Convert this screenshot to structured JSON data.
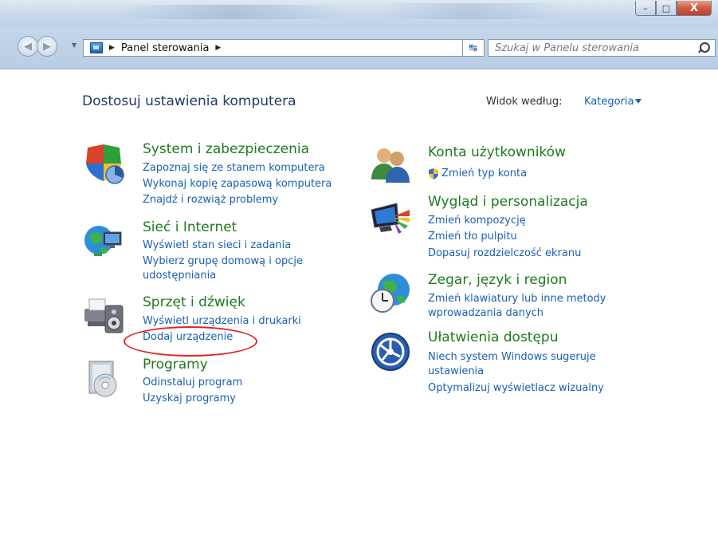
{
  "window": {
    "controls": {
      "minimize": "–",
      "maximize": "□",
      "close": "X"
    }
  },
  "nav": {
    "back_icon": "back-arrow-icon",
    "forward_icon": "forward-arrow-icon",
    "breadcrumb": [
      "Panel sterowania"
    ],
    "search_placeholder": "Szukaj w Panelu sterowania"
  },
  "header": {
    "title": "Dostosuj ustawienia komputera",
    "view_by_label": "Widok według:",
    "view_by_value": "Kategoria"
  },
  "categories_left": [
    {
      "title": "System i zabezpieczenia",
      "icon": "shield-pie-icon",
      "links": [
        "Zapoznaj się ze stanem komputera",
        "Wykonaj kopię zapasową komputera",
        "Znajdź i rozwiąż problemy"
      ]
    },
    {
      "title": "Sieć i Internet",
      "icon": "network-globe-icon",
      "links": [
        "Wyświetl stan sieci i zadania",
        "Wybierz grupę domową i opcje",
        "udostępniania"
      ]
    },
    {
      "title": "Sprzęt i dźwięk",
      "icon": "printer-speaker-icon",
      "links": [
        "Wyświetl urządzenia i drukarki",
        "Dodaj urządzenie"
      ]
    },
    {
      "title": "Programy",
      "icon": "programs-disc-icon",
      "links": [
        "Odinstaluj program",
        "Uzyskaj programy"
      ]
    }
  ],
  "categories_right": [
    {
      "title": "Konta użytkowników",
      "icon": "users-icon",
      "links": [
        "Zmień typ konta"
      ]
    },
    {
      "title": "Wygląd i personalizacja",
      "icon": "monitor-palette-icon",
      "links": [
        "Zmień kompozycję",
        "Zmień tło pulpitu",
        "Dopasuj rozdzielczość ekranu"
      ]
    },
    {
      "title": "Zegar, język i region",
      "icon": "globe-clock-icon",
      "links": [
        "Zmień klawiatury lub inne metody",
        "wprowadzania danych"
      ]
    },
    {
      "title": "Ułatwienia dostępu",
      "icon": "accessibility-icon",
      "links": [
        "Niech system Windows sugeruje",
        "ustawienia",
        "Optymalizuj wyświetlacz wizualny"
      ]
    }
  ],
  "colors": {
    "category_title": "#1e7a1e",
    "link": "#1a5fb4",
    "heading": "#1e3b6a",
    "annotation": "#e02424"
  }
}
